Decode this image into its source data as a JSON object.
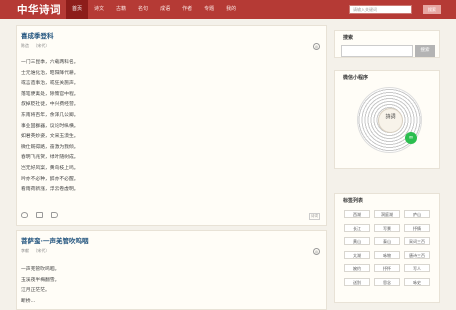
{
  "header": {
    "logo": "中华诗词",
    "nav": [
      "首页",
      "诗文",
      "古籍",
      "名句",
      "成语",
      "作者",
      "专题",
      "我的"
    ],
    "active_index": 0,
    "search_placeholder": "请输入关键词",
    "search_button": "搜索"
  },
  "poems": [
    {
      "title": "喜成季登科",
      "author": "陈造",
      "dynasty": "〔宋代〕",
      "lines": [
        "一门三昆季，六载两科名。",
        "士元谁化治，昭阳降代耕。",
        "或言造事治，或狂关施声。",
        "落笔便禽处，除策官中程。",
        "叔掉贬社徒，中兴费经营。",
        "东南将百年，余泽几公卿。",
        "事业固群器，议论时纵横。",
        "如君英妙姿，文采玉漠生。",
        "微仕既得路，奋激为我倾。",
        "春明飞兆贺，绿叶随树成。",
        "岂无好风案，黄鸟枝上鸣。",
        "吟亦不必种，醉亦不必醒。",
        "看雨荷新涨，浮云卷虚明。"
      ],
      "badge": "诗词"
    },
    {
      "title": "菩萨蛮·一声羌管吹呜咽",
      "author": "李献",
      "dynasty": "〔宋代〕",
      "lines": [
        "一声羌管吹呜咽。",
        "玉溪夜半梅翻雪。",
        "江月正茫茫。",
        "断桥..."
      ]
    }
  ],
  "sidebar": {
    "search_title": "搜索",
    "search_button": "搜索",
    "wechat_title": "微信小程序",
    "qr_text": "詩詞",
    "tags_title": "标签列表",
    "tags": [
      "西湖",
      "洞庭湖",
      "庐山",
      "长江",
      "写景",
      "抒情",
      "黄山",
      "泰山",
      "采词三百",
      "太湖",
      "咏物",
      "唐诗三百",
      "婉约",
      "抒怀",
      "写人",
      "送别",
      "思念",
      "咏史"
    ]
  }
}
